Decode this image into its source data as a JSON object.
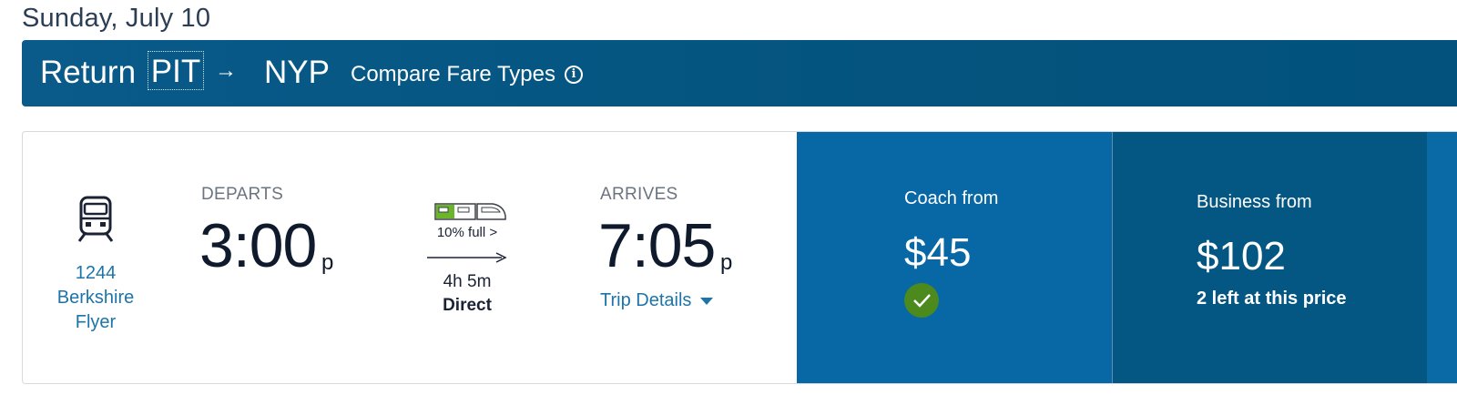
{
  "date_heading": "Sunday, July 10",
  "route": {
    "label": "Return",
    "origin": "PIT",
    "arrow": "→",
    "destination": "NYP",
    "compare_link": "Compare Fare Types",
    "info_icon": "i"
  },
  "trip": {
    "train_number": "1244",
    "train_name_line1": "Berkshire",
    "train_name_line2": "Flyer",
    "departs_label": "DEPARTS",
    "depart_time": "3:00",
    "depart_ampm": "p",
    "capacity": "10% full >",
    "duration": "4h 5m",
    "stops": "Direct",
    "arrives_label": "ARRIVES",
    "arrive_time": "7:05",
    "arrive_ampm": "p",
    "trip_details": "Trip Details"
  },
  "fares": {
    "coach": {
      "title": "Coach from",
      "price": "$45",
      "selected": true
    },
    "business": {
      "title": "Business from",
      "price": "$102",
      "note": "2 left at this price"
    }
  },
  "icons": {
    "train": "train-front-icon",
    "capacity": "train-capacity-icon",
    "info": "info-icon",
    "caret": "chevron-down-icon",
    "check": "checkmark-icon",
    "arrow": "arrow-right-icon"
  },
  "colors": {
    "header_bar": "#04547f",
    "coach_panel": "#0867a5",
    "business_panel": "#045683",
    "link": "#1c74a8",
    "check_badge": "#4c8a1e",
    "capacity_green": "#6bb52a"
  }
}
